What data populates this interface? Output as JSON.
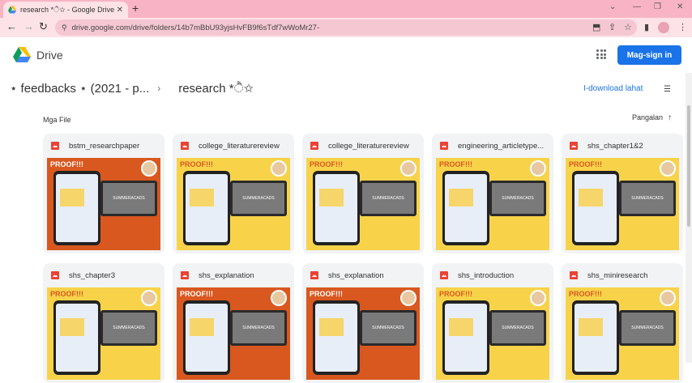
{
  "browser": {
    "tab_title": "research *ੈ✩ - Google Drive",
    "tab_close": "✕",
    "new_tab": "+",
    "url": "drive.google.com/drive/folders/14b7mBbU93yjsHvFB9f6sTdf7wWoMr27-",
    "window_controls": [
      "⌄",
      "—",
      "❐",
      "✕"
    ]
  },
  "header": {
    "brand": "Drive",
    "signin_label": "Mag-sign in"
  },
  "breadcrumb": {
    "parent": "⋆ feedbacks ⋆ (2021 - p...",
    "separator": "›",
    "current": "research *ੈ✩"
  },
  "actions": {
    "download_label": "I-download lahat"
  },
  "files_section": {
    "label": "Mga File",
    "sort_label": "Pangalan",
    "sort_arrow": "↑"
  },
  "files": [
    {
      "name": "bstm_researchpaper",
      "theme": "orange"
    },
    {
      "name": "college_literaturereview",
      "theme": "yellow"
    },
    {
      "name": "college_literaturereview",
      "theme": "yellow"
    },
    {
      "name": "engineering_articletype...",
      "theme": "yellow"
    },
    {
      "name": "shs_chapter1&2",
      "theme": "yellow"
    },
    {
      "name": "shs_chapter3",
      "theme": "yellow"
    },
    {
      "name": "shs_explanation",
      "theme": "orange"
    },
    {
      "name": "shs_explanation",
      "theme": "orange"
    },
    {
      "name": "shs_introduction",
      "theme": "yellow"
    },
    {
      "name": "shs_miniresearch",
      "theme": "yellow"
    }
  ],
  "thumbnail_text": {
    "proof": "PROOF!!!",
    "laptop": "SUMMERACADS"
  },
  "colors": {
    "tab_strip": "#f8b4c4",
    "accent": "#1a73e8",
    "thumb_orange": "#d9581f",
    "thumb_yellow": "#f8d34a"
  }
}
